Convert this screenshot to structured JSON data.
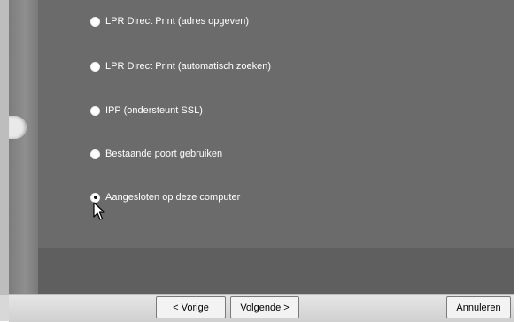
{
  "options": [
    {
      "label": "LPR Direct Print (adres opgeven)",
      "selected": false
    },
    {
      "label": "LPR Direct Print (automatisch zoeken)",
      "selected": false
    },
    {
      "label": "IPP (ondersteunt SSL)",
      "selected": false
    },
    {
      "label": "Bestaande poort gebruiken",
      "selected": false
    },
    {
      "label": "Aangesloten op deze computer",
      "selected": true
    }
  ],
  "buttons": {
    "back": "< Vorige",
    "next": "Volgende >",
    "cancel": "Annuleren"
  },
  "colors": {
    "panel": "#6b6b6b",
    "text": "#ffffff"
  }
}
